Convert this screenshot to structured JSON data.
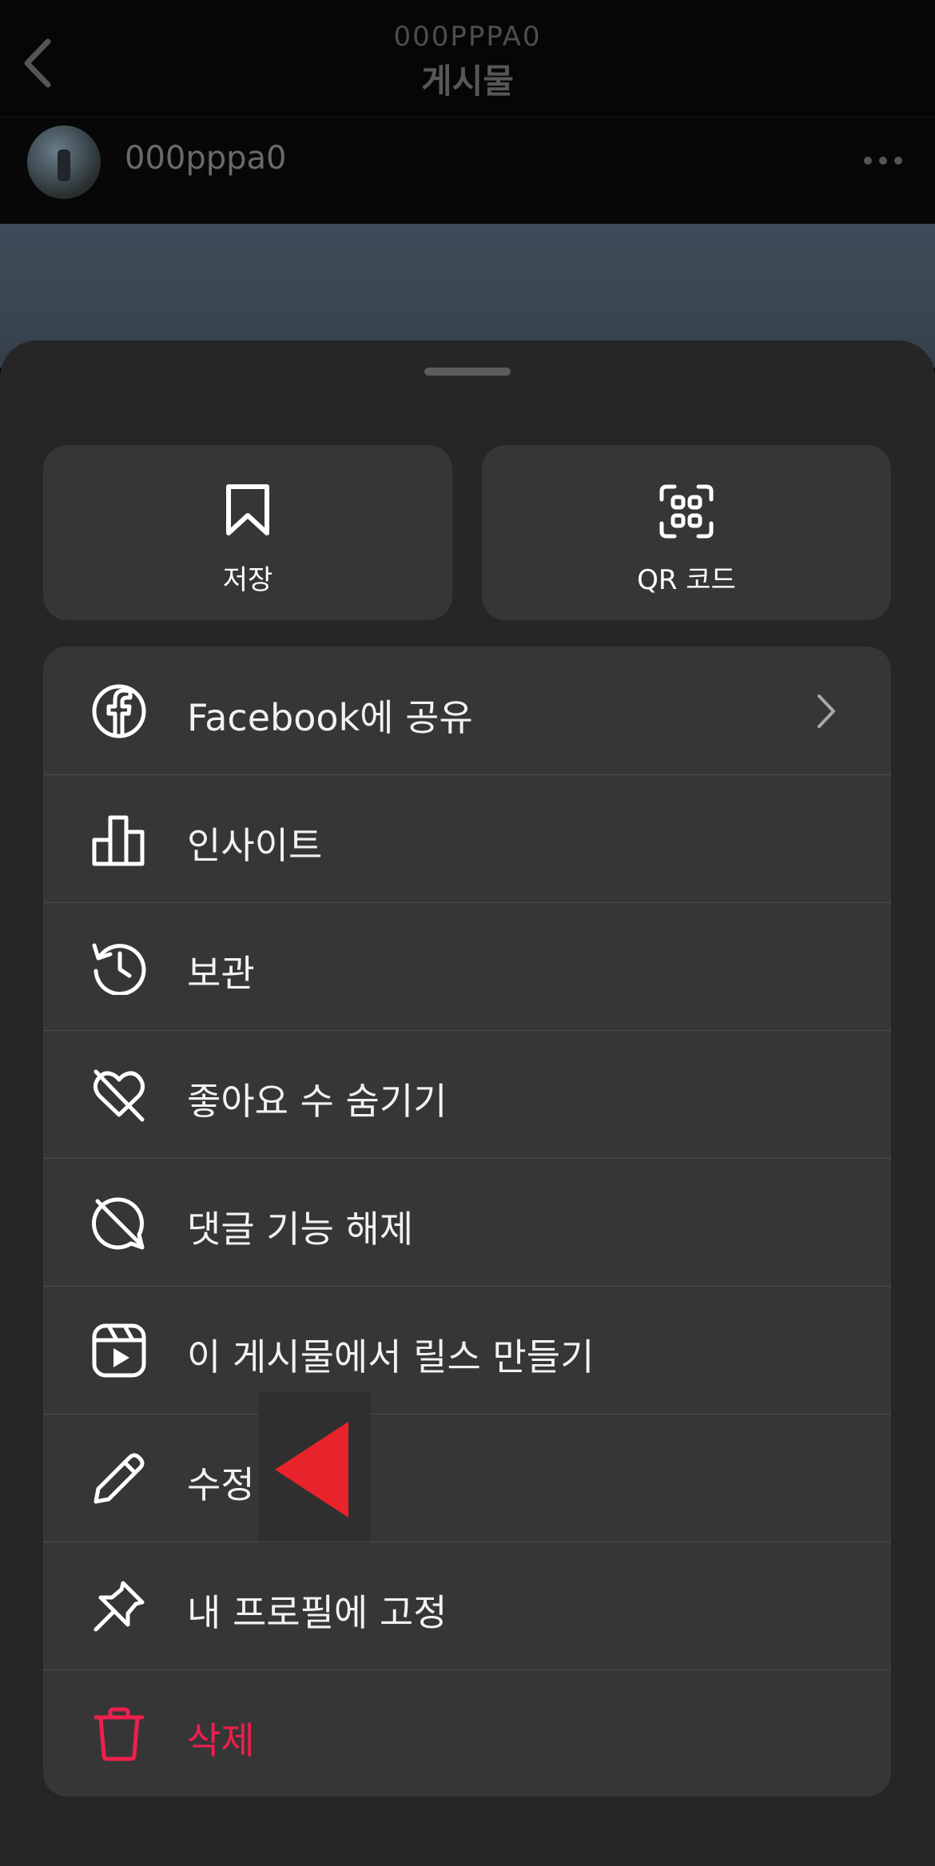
{
  "header": {
    "subtitle": "000PPPA0",
    "title": "게시물"
  },
  "post": {
    "username": "000pppa0"
  },
  "tiles": [
    {
      "id": "save",
      "label": "저장",
      "icon": "bookmark-icon"
    },
    {
      "id": "qr",
      "label": "QR 코드",
      "icon": "qr-scan-icon"
    }
  ],
  "menu": [
    {
      "label": "Facebook에 공유",
      "icon": "facebook-icon",
      "chevron": true
    },
    {
      "label": "인사이트",
      "icon": "insights-bar-chart-icon"
    },
    {
      "label": "보관",
      "icon": "archive-history-icon"
    },
    {
      "label": "좋아요 수 숨기기",
      "icon": "heart-slash-icon"
    },
    {
      "label": "댓글 기능 해제",
      "icon": "comment-off-icon"
    },
    {
      "label": "이 게시물에서 릴스 만들기",
      "icon": "reels-icon"
    },
    {
      "label": "수정",
      "icon": "pencil-icon"
    },
    {
      "label": "내 프로필에 고정",
      "icon": "pin-icon"
    },
    {
      "label": "삭제",
      "icon": "trash-icon",
      "danger": true
    }
  ],
  "colors": {
    "danger": "#ef1f4d",
    "annotation_arrow": "#e8232b",
    "sheet": "#262626",
    "card": "#363636"
  }
}
